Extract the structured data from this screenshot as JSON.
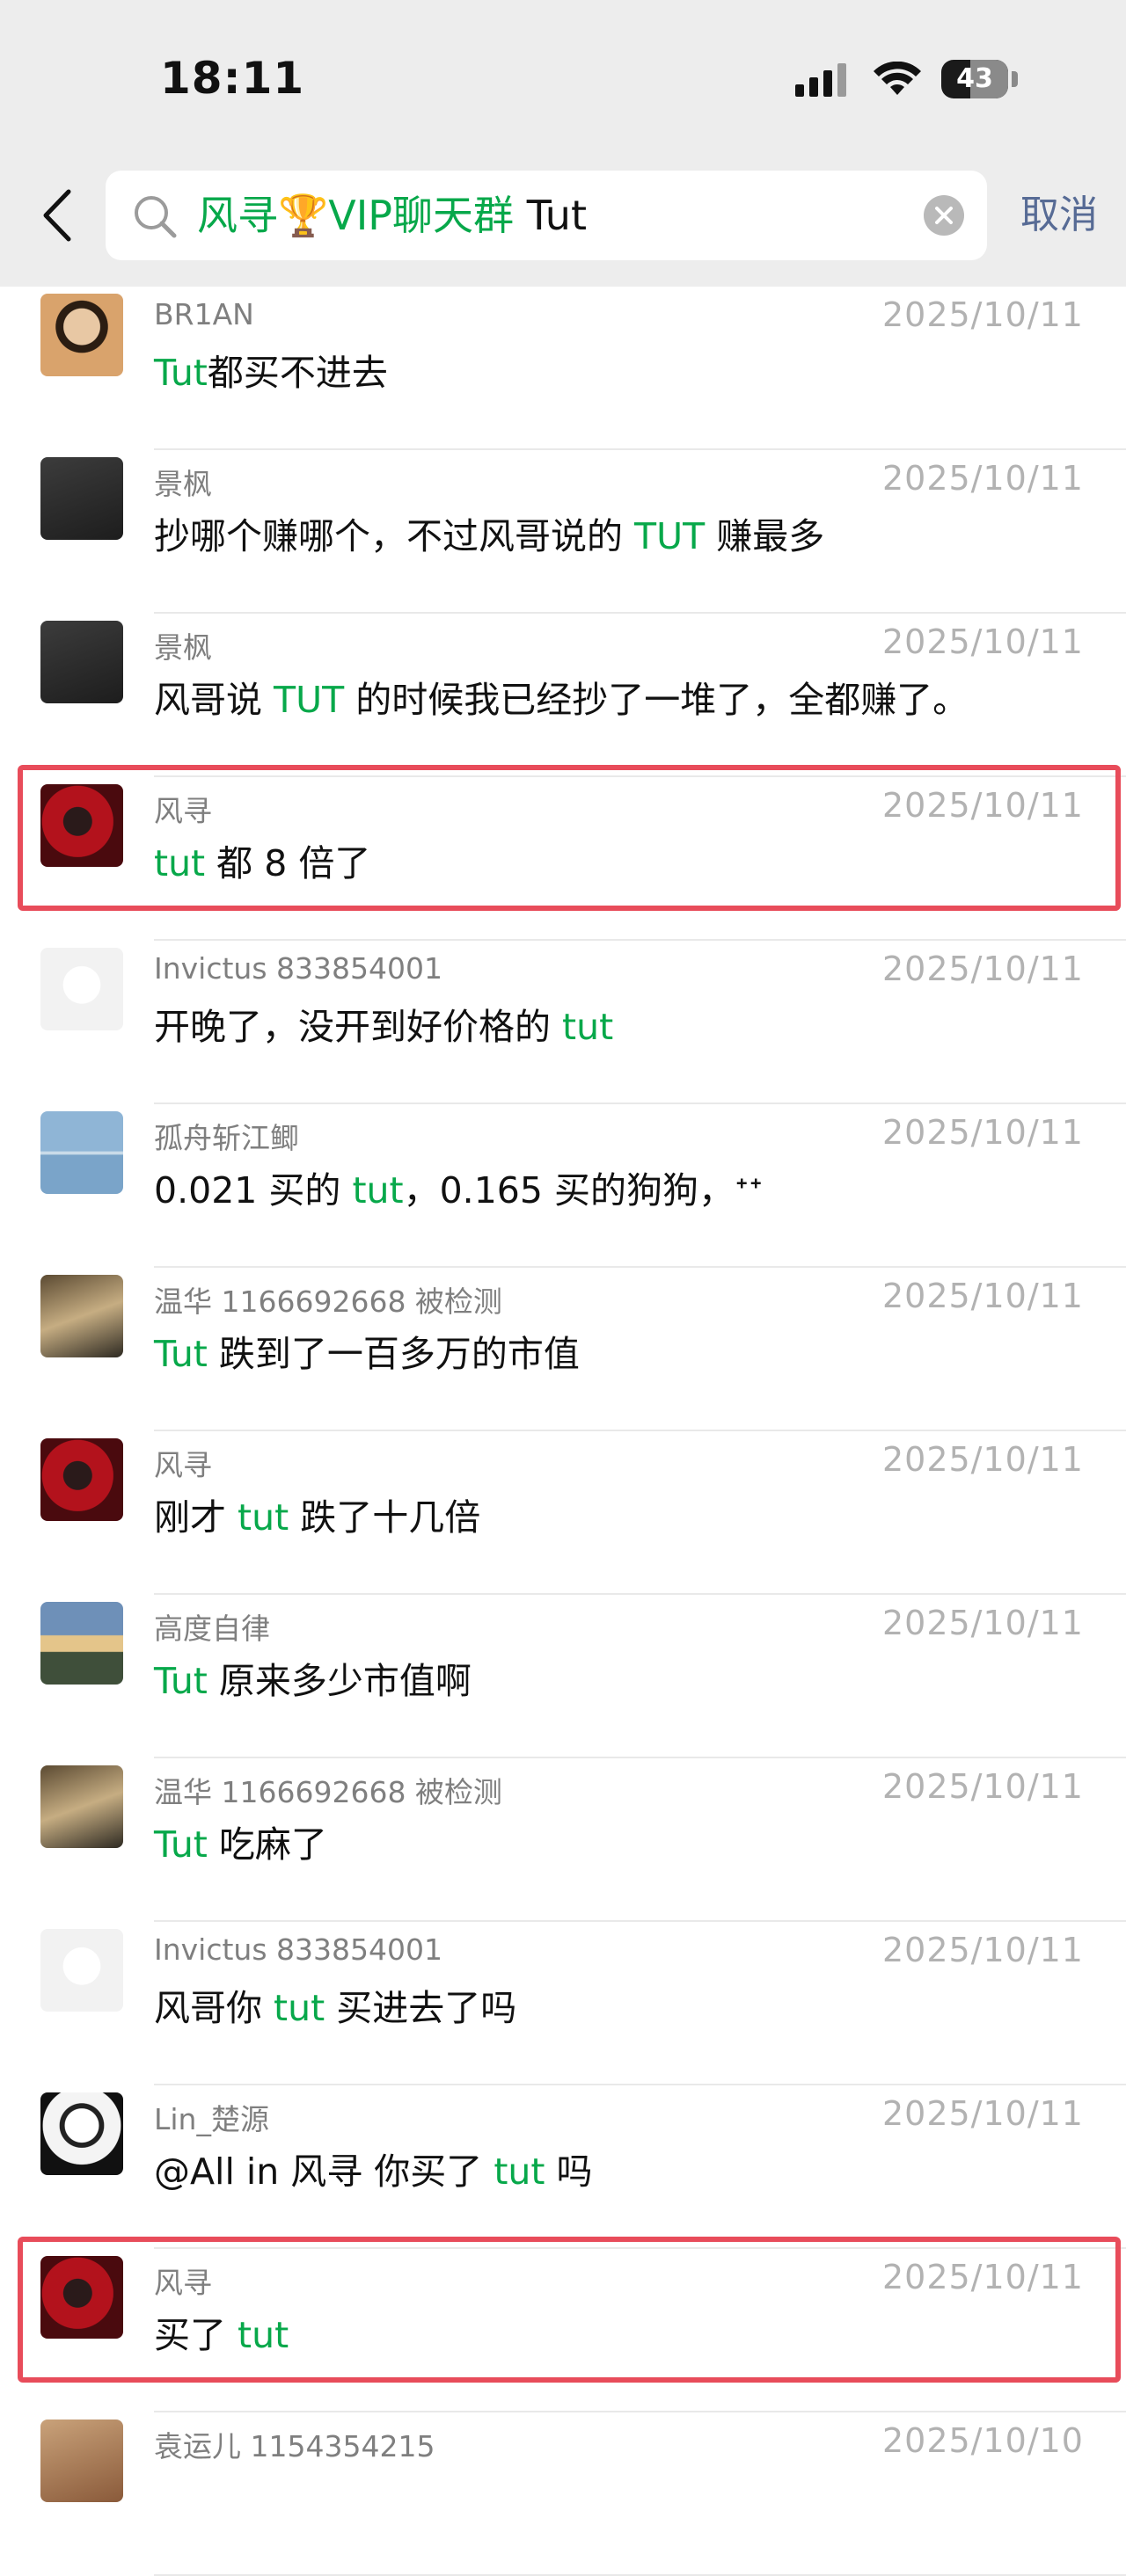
{
  "status": {
    "time": "18:11",
    "battery": "43"
  },
  "header": {
    "search_chat": "风寻🏆VIP聊天群",
    "search_term": "Tut",
    "cancel_label": "取消"
  },
  "results": [
    {
      "sender": "BR1AN",
      "date": "2025/10/11",
      "parts": [
        {
          "t": "Tut",
          "h": true
        },
        {
          "t": "都买不进去",
          "h": false
        }
      ]
    },
    {
      "sender": "景枫",
      "date": "2025/10/11",
      "parts": [
        {
          "t": "抄哪个赚哪个，不过风哥说的 ",
          "h": false
        },
        {
          "t": "TUT",
          "h": true
        },
        {
          "t": " 赚最多",
          "h": false
        }
      ]
    },
    {
      "sender": "景枫",
      "date": "2025/10/11",
      "parts": [
        {
          "t": "风哥说 ",
          "h": false
        },
        {
          "t": "TUT",
          "h": true
        },
        {
          "t": " 的时候我已经抄了一堆了，全都赚了。",
          "h": false
        }
      ]
    },
    {
      "sender": "风寻",
      "date": "2025/10/11",
      "parts": [
        {
          "t": "tut",
          "h": true
        },
        {
          "t": " 都 8 倍了",
          "h": false
        }
      ]
    },
    {
      "sender": "Invictus 833854001",
      "date": "2025/10/11",
      "parts": [
        {
          "t": "开晚了，没开到好价格的 ",
          "h": false
        },
        {
          "t": "tut",
          "h": true
        }
      ]
    },
    {
      "sender": "孤舟斩江鲫",
      "date": "2025/10/11",
      "parts": [
        {
          "t": "0.021 买的 ",
          "h": false
        },
        {
          "t": "tut",
          "h": true
        },
        {
          "t": "，0.165 买的狗狗，ᐩᐩ",
          "h": false
        }
      ]
    },
    {
      "sender": "温华 1166692668 被检测",
      "date": "2025/10/11",
      "parts": [
        {
          "t": "Tut",
          "h": true
        },
        {
          "t": " 跌到了一百多万的市值",
          "h": false
        }
      ]
    },
    {
      "sender": "风寻",
      "date": "2025/10/11",
      "parts": [
        {
          "t": "刚才 ",
          "h": false
        },
        {
          "t": "tut",
          "h": true
        },
        {
          "t": " 跌了十几倍",
          "h": false
        }
      ]
    },
    {
      "sender": "高度自律",
      "date": "2025/10/11",
      "parts": [
        {
          "t": "Tut",
          "h": true
        },
        {
          "t": " 原来多少市值啊",
          "h": false
        }
      ]
    },
    {
      "sender": "温华 1166692668 被检测",
      "date": "2025/10/11",
      "parts": [
        {
          "t": "Tut",
          "h": true
        },
        {
          "t": " 吃麻了",
          "h": false
        }
      ]
    },
    {
      "sender": "Invictus 833854001",
      "date": "2025/10/11",
      "parts": [
        {
          "t": "风哥你 ",
          "h": false
        },
        {
          "t": "tut",
          "h": true
        },
        {
          "t": " 买进去了吗",
          "h": false
        }
      ]
    },
    {
      "sender": "Lin_楚源",
      "date": "2025/10/11",
      "parts": [
        {
          "t": "@All in 风寻 你买了 ",
          "h": false
        },
        {
          "t": "tut",
          "h": true
        },
        {
          "t": " 吗",
          "h": false
        }
      ]
    },
    {
      "sender": "风寻",
      "date": "2025/10/11",
      "parts": [
        {
          "t": "买了 ",
          "h": false
        },
        {
          "t": "tut",
          "h": true
        }
      ]
    },
    {
      "sender": "袁运儿 1154354215",
      "date": "2025/10/10",
      "parts": []
    }
  ],
  "highlighted_rows": [
    3,
    12
  ],
  "colors": {
    "highlight_text": "#07a84a",
    "annotation_box": "#e84c5a",
    "cancel_link": "#576b95"
  },
  "icons": [
    "back-chevron-icon",
    "search-icon",
    "clear-icon",
    "signal-icon",
    "wifi-icon",
    "battery-icon"
  ]
}
